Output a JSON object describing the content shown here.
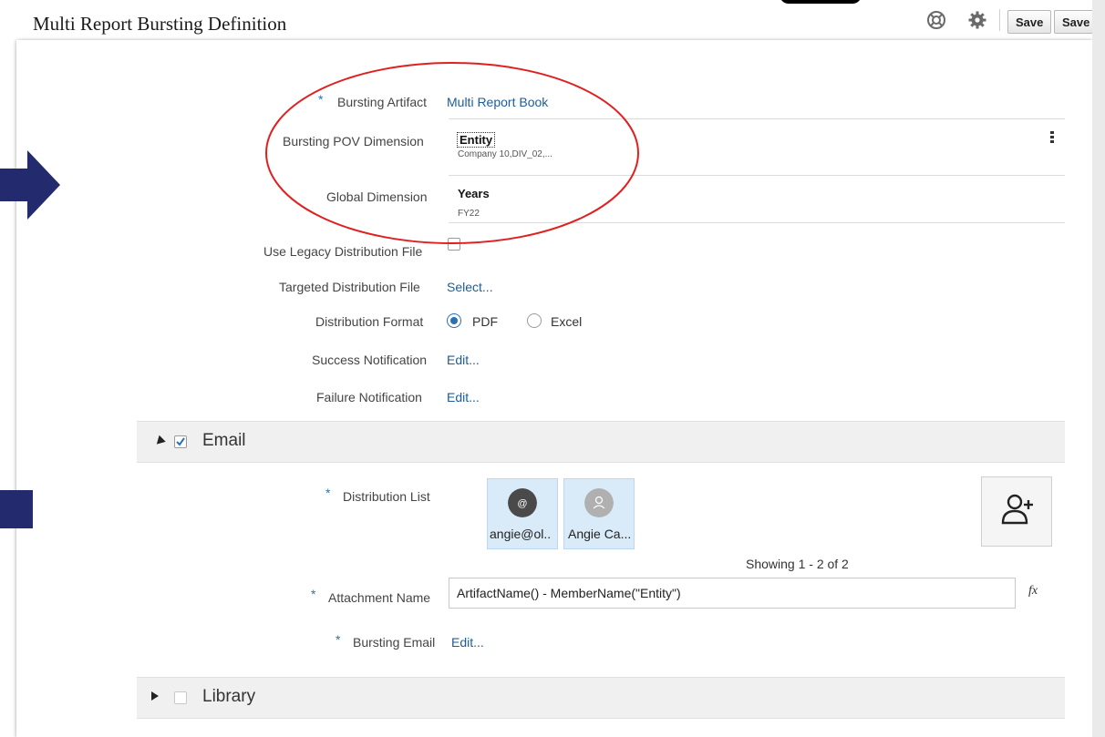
{
  "header": {
    "title": "Multi Report Bursting Definition",
    "save_label": "Save",
    "save_as_label": "Save",
    "help_icon": "lifebuoy-icon",
    "settings_icon": "gear-icon"
  },
  "form": {
    "bursting_artifact": {
      "label": "Bursting Artifact",
      "value": "Multi Report Book",
      "required": "*"
    },
    "bursting_pov": {
      "label": "Bursting POV Dimension",
      "dimension": "Entity",
      "members": "Company 10,DIV_02,..."
    },
    "global_dimension": {
      "label": "Global Dimension",
      "dimension": "Years",
      "members": "FY22"
    },
    "legacy_distribution": {
      "label": "Use Legacy Distribution File"
    },
    "targeted_distribution": {
      "label": "Targeted Distribution File",
      "link": "Select..."
    },
    "distribution_format": {
      "label": "Distribution Format",
      "options": [
        "PDF",
        "Excel"
      ],
      "selected": "PDF"
    },
    "success_notification": {
      "label": "Success Notification",
      "link": "Edit..."
    },
    "failure_notification": {
      "label": "Failure Notification",
      "link": "Edit..."
    }
  },
  "email_section": {
    "title": "Email",
    "checked": true,
    "distribution_list": {
      "label": "Distribution List",
      "required": "*",
      "recipients": [
        "angie@ol..",
        "Angie Ca..."
      ],
      "showing": "Showing 1 - 2 of 2"
    },
    "attachment_name": {
      "label": "Attachment Name",
      "required": "*",
      "value": "ArtifactName() - MemberName(\"Entity\")",
      "fx": "fx"
    },
    "bursting_email": {
      "label": "Bursting Email",
      "required": "*",
      "link": "Edit..."
    }
  },
  "library_section": {
    "title": "Library",
    "checked": false
  },
  "colors": {
    "link": "#1c5d99",
    "accent": "#2b6fb6",
    "annotation_circle": "#e02020",
    "arrow": "#232a6e"
  }
}
